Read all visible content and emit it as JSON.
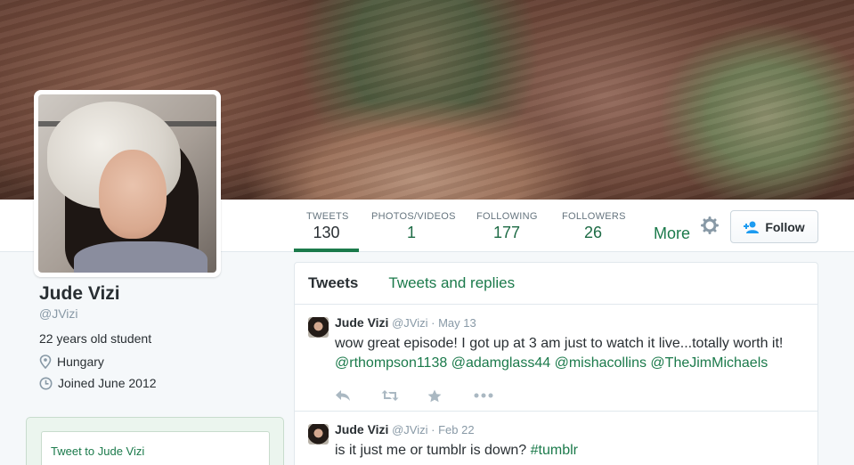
{
  "profile": {
    "name": "Jude Vizi",
    "handle": "@JVizi",
    "bio": "22 years old student",
    "location": "Hungary",
    "joined": "Joined June 2012"
  },
  "stats": [
    {
      "label": "TWEETS",
      "value": "130"
    },
    {
      "label": "PHOTOS/VIDEOS",
      "value": "1"
    },
    {
      "label": "FOLLOWING",
      "value": "177"
    },
    {
      "label": "FOLLOWERS",
      "value": "26"
    }
  ],
  "nav": {
    "more_label": "More",
    "follow_label": "Follow"
  },
  "tweet_box": {
    "label": "Tweet to Jude Vizi"
  },
  "tabs": [
    {
      "label": "Tweets"
    },
    {
      "label": "Tweets and replies"
    }
  ],
  "tweets": [
    {
      "name": "Jude Vizi",
      "handle": "@JVizi",
      "sep": "·",
      "date": "May 13",
      "text": "wow great episode! I got up at 3 am just to watch it live...totally worth it!",
      "mentions": [
        "@rthompson1138",
        "@adamglass44",
        "@mishacollins",
        "@TheJimMichaels"
      ]
    },
    {
      "name": "Jude Vizi",
      "handle": "@JVizi",
      "sep": "·",
      "date": "Feb 22",
      "text": "is it just me or tumblr is down?",
      "hashtag": "#tumblr"
    }
  ],
  "colors": {
    "accent": "#1b7a4b",
    "muted": "#8899a6",
    "text": "#292f33"
  }
}
